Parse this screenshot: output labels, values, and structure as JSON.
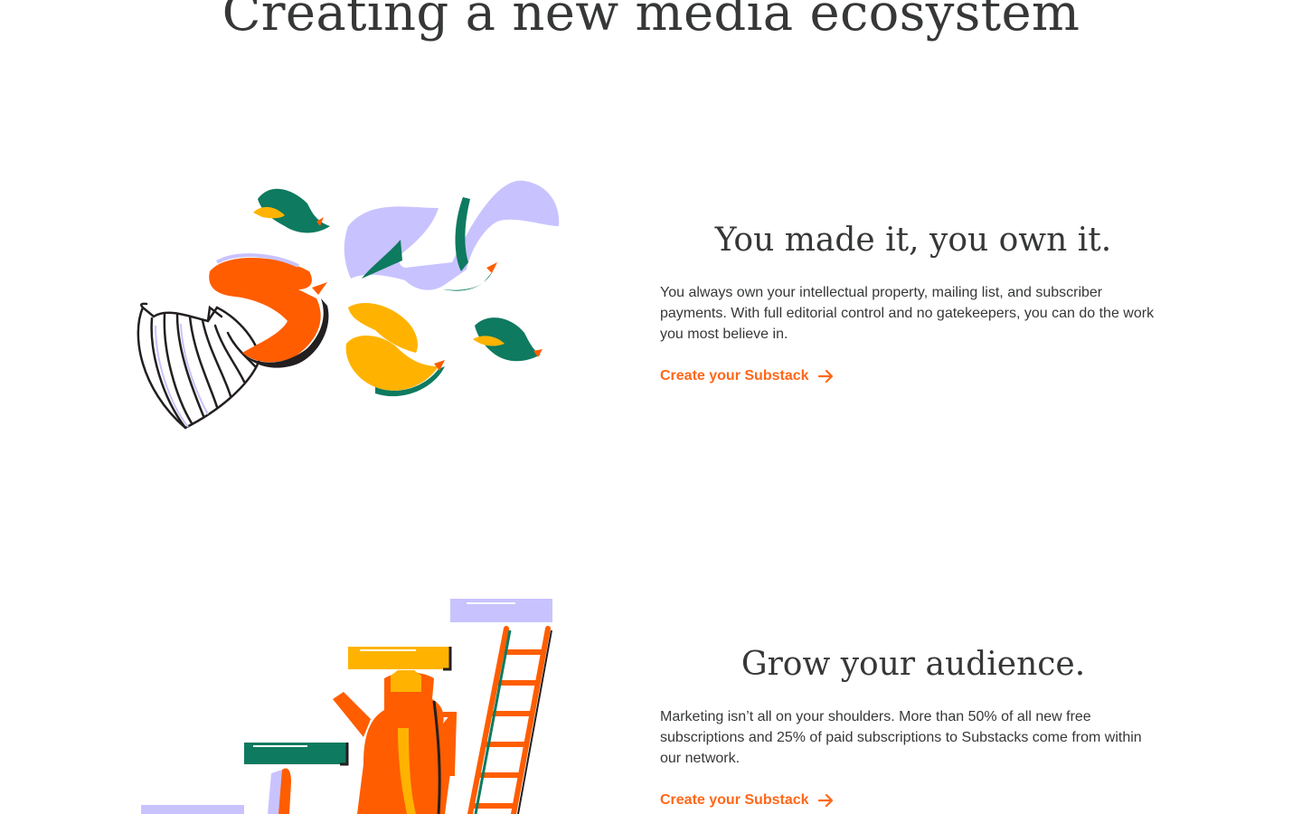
{
  "page": {
    "title": "Creating a new media ecosystem"
  },
  "features": [
    {
      "heading": "You made it, you own it.",
      "body": "You always own your intellectual property, mailing list, and subscriber payments. With full editorial control and no gatekeepers, you can do the work you most believe in.",
      "cta_label": "Create your Substack",
      "illustration_icon": "birdcage-birds-illustration"
    },
    {
      "heading": "Grow your audience.",
      "body": "Marketing isn’t all on your shoulders. More than 50% of all new free subscriptions and 25% of paid subscriptions to Substacks come from within our network.",
      "cta_label": "Create your Substack",
      "illustration_icon": "ladder-teapot-illustration"
    }
  ],
  "colors": {
    "accent": "#ff6719",
    "text": "#363737",
    "lavender": "#c8c3ff",
    "green": "#0e7a5f",
    "yellow": "#ffb300",
    "orange": "#ff5d00",
    "ink": "#231f20"
  }
}
